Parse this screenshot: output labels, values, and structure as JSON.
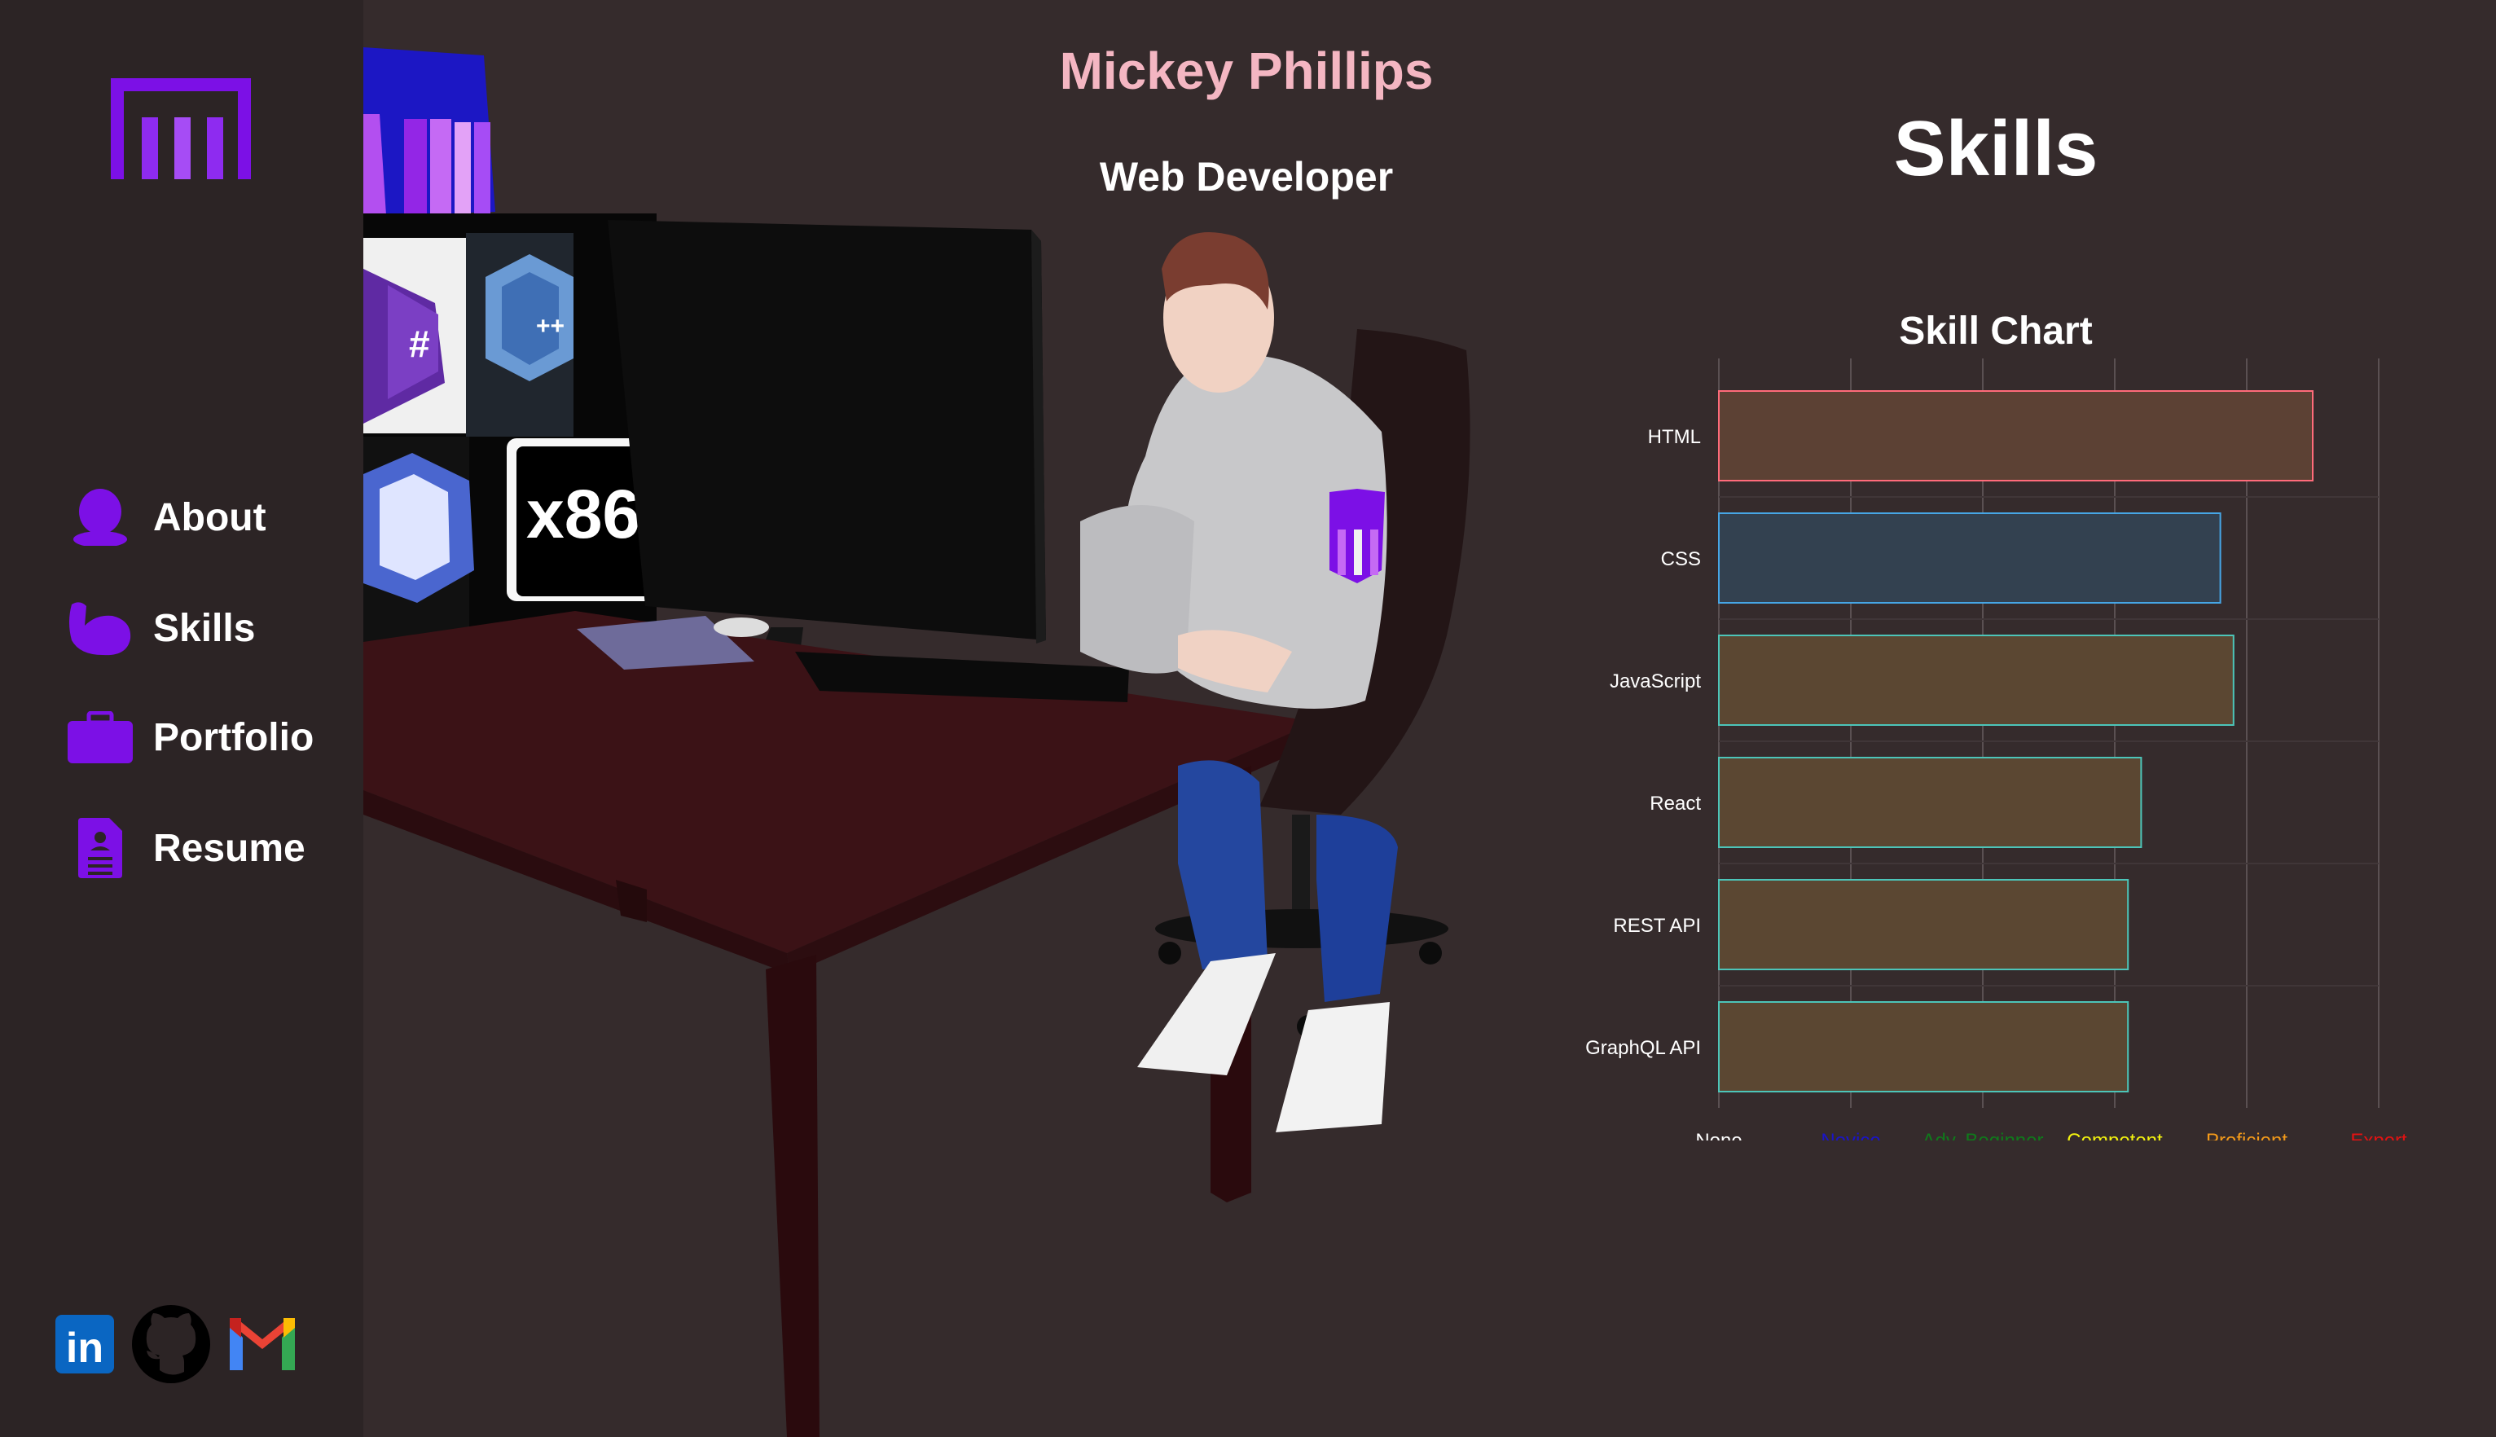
{
  "sidebar": {
    "logo_icon": "mp-logo-icon",
    "nav": [
      {
        "label": "About",
        "icon": "person-icon"
      },
      {
        "label": "Skills",
        "icon": "flexed-arm-icon"
      },
      {
        "label": "Portfolio",
        "icon": "briefcase-icon"
      },
      {
        "label": "Resume",
        "icon": "resume-icon"
      }
    ],
    "socials": [
      {
        "name": "linkedin-icon",
        "text": "in"
      },
      {
        "name": "github-icon"
      },
      {
        "name": "gmail-icon"
      }
    ],
    "accent_color": "#7c10e6"
  },
  "hero": {
    "name": "Mickey Phillips",
    "role": "Web Developer",
    "name_color": "#f4b6c2",
    "screen_tiles": [
      "#",
      "++",
      "x86"
    ]
  },
  "skills": {
    "heading": "Skills"
  },
  "chart_data": {
    "type": "bar",
    "orientation": "horizontal",
    "title": "Skill Chart",
    "categories": [
      "HTML",
      "CSS",
      "JavaScript",
      "React",
      "REST API",
      "GraphQL API"
    ],
    "values": [
      4.5,
      3.8,
      3.9,
      3.2,
      3.1,
      3.1
    ],
    "x_ticks": [
      {
        "label": "None",
        "color": "#ffffff"
      },
      {
        "label": "Novice",
        "color": "#1a14c8"
      },
      {
        "label": "Adv. Beginner",
        "color": "#0f7a1b"
      },
      {
        "label": "Competent",
        "color": "#f2f20f"
      },
      {
        "label": "Proficient",
        "color": "#f39a1a"
      },
      {
        "label": "Expert",
        "color": "#e31212"
      }
    ],
    "xlim": [
      0,
      5
    ],
    "bar_colors": [
      {
        "fill": "#5c4134",
        "stroke": "#ff6b7a"
      },
      {
        "fill": "#334150",
        "stroke": "#46a6e6"
      },
      {
        "fill": "#5b4732",
        "stroke": "#4cc5b9"
      },
      {
        "fill": "#5b4732",
        "stroke": "#4cc5b9"
      },
      {
        "fill": "#5b4732",
        "stroke": "#4cc5b9"
      },
      {
        "fill": "#5b4732",
        "stroke": "#4cc5b9"
      }
    ],
    "grid": true
  }
}
